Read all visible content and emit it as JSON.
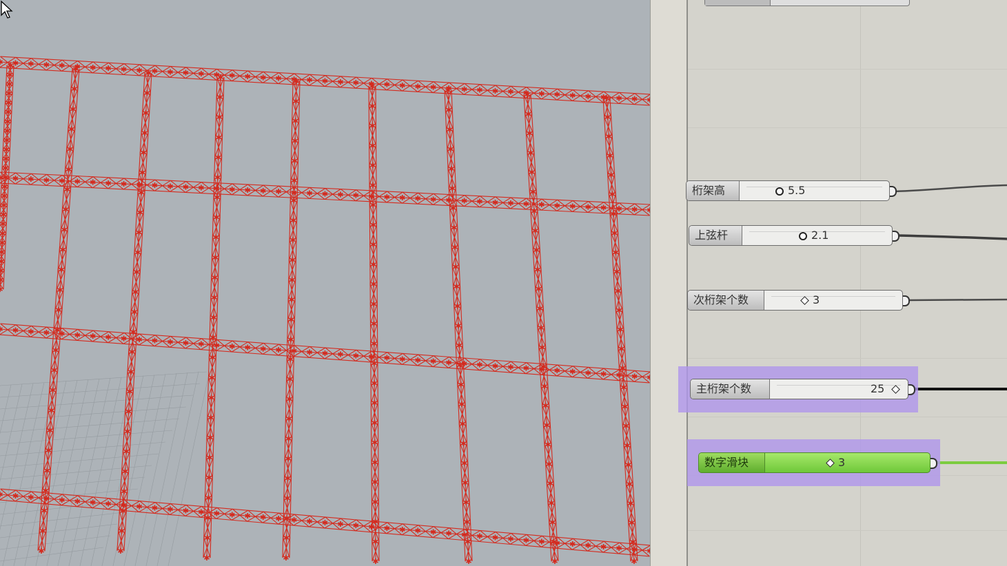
{
  "viewport": {
    "label": "Rhino 3D viewport - truss structure preview",
    "structure_color": "#d42a1e",
    "background_color": "#adb3b8"
  },
  "canvas": {
    "background_color": "#d4d3cc"
  },
  "sliders": [
    {
      "label": "桁架高",
      "value": "5.5",
      "knob": "circle",
      "state": "normal"
    },
    {
      "label": "上弦杆",
      "value": "2.1",
      "knob": "circle",
      "state": "normal"
    },
    {
      "label": "次桁架个数",
      "value": "3",
      "knob": "diamond",
      "state": "normal"
    },
    {
      "label": "主桁架个数",
      "value": "25",
      "knob": "diamond",
      "state": "selected"
    },
    {
      "label": "数字滑块",
      "value": "3",
      "knob": "diamond",
      "state": "selected-active"
    }
  ],
  "colors": {
    "selection": "#b196eb",
    "active_green": "#7ccc3f",
    "wire": "#444444"
  },
  "icons": {
    "cursor": "arrow-cursor-icon"
  }
}
